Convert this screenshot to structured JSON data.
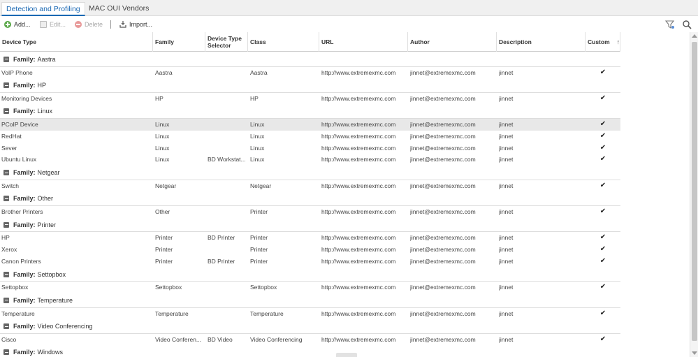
{
  "tabs": [
    {
      "label": "Detection and Profiling",
      "active": true
    },
    {
      "label": "MAC OUI Vendors",
      "active": false
    }
  ],
  "toolbar": {
    "add_label": "Add...",
    "edit_label": "Edit...",
    "delete_label": "Delete",
    "separator": "|",
    "import_label": "Import..."
  },
  "columns": {
    "device_type": "Device Type",
    "family": "Family",
    "selector": "Device Type Selector",
    "class": "Class",
    "url": "URL",
    "author": "Author",
    "description": "Description",
    "custom": "Custom"
  },
  "groups": [
    {
      "prefix": "Family:",
      "name": "Aastra",
      "rows": [
        {
          "device_type": "VoIP Phone",
          "family": "Aastra",
          "selector": "",
          "class": "Aastra",
          "url": "http://www.extremexmc.com",
          "author": "jinnet@extremexmc.com",
          "description": "jinnet",
          "custom": "✔"
        }
      ]
    },
    {
      "prefix": "Family:",
      "name": "HP",
      "rows": [
        {
          "device_type": "Monitoring Devices",
          "family": "HP",
          "selector": "",
          "class": "HP",
          "url": "http://www.extremexmc.com",
          "author": "jinnet@extremexmc.com",
          "description": "jinnet",
          "custom": "✔"
        }
      ]
    },
    {
      "prefix": "Family:",
      "name": "Linux",
      "rows": [
        {
          "device_type": "PCoIP Device",
          "family": "Linux",
          "selector": "",
          "class": "Linux",
          "url": "http://www.extremexmc.com",
          "author": "jinnet@extremexmc.com",
          "description": "jinnet",
          "custom": "✔",
          "selected": true
        },
        {
          "device_type": "RedHat",
          "family": "Linux",
          "selector": "",
          "class": "Linux",
          "url": "http://www.extremexmc.com",
          "author": "jinnet@extremexmc.com",
          "description": "jinnet",
          "custom": "✔"
        },
        {
          "device_type": "Sever",
          "family": "Linux",
          "selector": "",
          "class": "Linux",
          "url": "http://www.extremexmc.com",
          "author": "jinnet@extremexmc.com",
          "description": "jinnet",
          "custom": "✔"
        },
        {
          "device_type": "Ubuntu Linux",
          "family": "Linux",
          "selector": "BD Workstat...",
          "class": "Linux",
          "url": "http://www.extremexmc.com",
          "author": "jinnet@extremexmc.com",
          "description": "jinnet",
          "custom": "✔"
        }
      ]
    },
    {
      "prefix": "Family:",
      "name": "Netgear",
      "rows": [
        {
          "device_type": "Switch",
          "family": "Netgear",
          "selector": "",
          "class": "Netgear",
          "url": "http://www.extremexmc.com",
          "author": "jinnet@extremexmc.com",
          "description": "jinnet",
          "custom": "✔"
        }
      ]
    },
    {
      "prefix": "Family:",
      "name": "Other",
      "rows": [
        {
          "device_type": "Brother Printers",
          "family": "Other",
          "selector": "",
          "class": "Printer",
          "url": "http://www.extremexmc.com",
          "author": "jinnet@extremexmc.com",
          "description": "jinnet",
          "custom": "✔"
        }
      ]
    },
    {
      "prefix": "Family:",
      "name": "Printer",
      "rows": [
        {
          "device_type": "HP",
          "family": "Printer",
          "selector": "BD Printer",
          "class": "Printer",
          "url": "http://www.extremexmc.com",
          "author": "jinnet@extremexmc.com",
          "description": "jinnet",
          "custom": "✔"
        },
        {
          "device_type": "Xerox",
          "family": "Printer",
          "selector": "",
          "class": "Printer",
          "url": "http://www.extremexmc.com",
          "author": "jinnet@extremexmc.com",
          "description": "jinnet",
          "custom": "✔"
        },
        {
          "device_type": "Canon Printers",
          "family": "Printer",
          "selector": "BD Printer",
          "class": "Printer",
          "url": "http://www.extremexmc.com",
          "author": "jinnet@extremexmc.com",
          "description": "jinnet",
          "custom": "✔"
        }
      ]
    },
    {
      "prefix": "Family:",
      "name": "Settopbox",
      "rows": [
        {
          "device_type": "Settopbox",
          "family": "Settopbox",
          "selector": "",
          "class": "Settopbox",
          "url": "http://www.extremexmc.com",
          "author": "jinnet@extremexmc.com",
          "description": "jinnet",
          "custom": "✔"
        }
      ]
    },
    {
      "prefix": "Family:",
      "name": "Temperature",
      "rows": [
        {
          "device_type": "Temperature",
          "family": "Temperature",
          "selector": "",
          "class": "Temperature",
          "url": "http://www.extremexmc.com",
          "author": "jinnet@extremexmc.com",
          "description": "jinnet",
          "custom": "✔"
        }
      ]
    },
    {
      "prefix": "Family:",
      "name": "Video Conferencing",
      "rows": [
        {
          "device_type": "Cisco",
          "family": "Video Conferen...",
          "selector": "BD Video",
          "class": "Video Conferencing",
          "url": "http://www.extremexmc.com",
          "author": "jinnet@extremexmc.com",
          "description": "jinnet",
          "custom": "✔"
        }
      ]
    },
    {
      "prefix": "Family:",
      "name": "Windows",
      "rows": []
    }
  ],
  "colors": {
    "accent": "#1a68b3",
    "selected_row": "#e8e8e8",
    "add_icon": "#5ba84a"
  },
  "icons": {
    "add": "add-icon",
    "edit": "edit-icon",
    "delete": "delete-icon",
    "import": "import-icon",
    "filter": "filter-icon",
    "search": "search-icon",
    "sort": "sort-asc-icon"
  }
}
